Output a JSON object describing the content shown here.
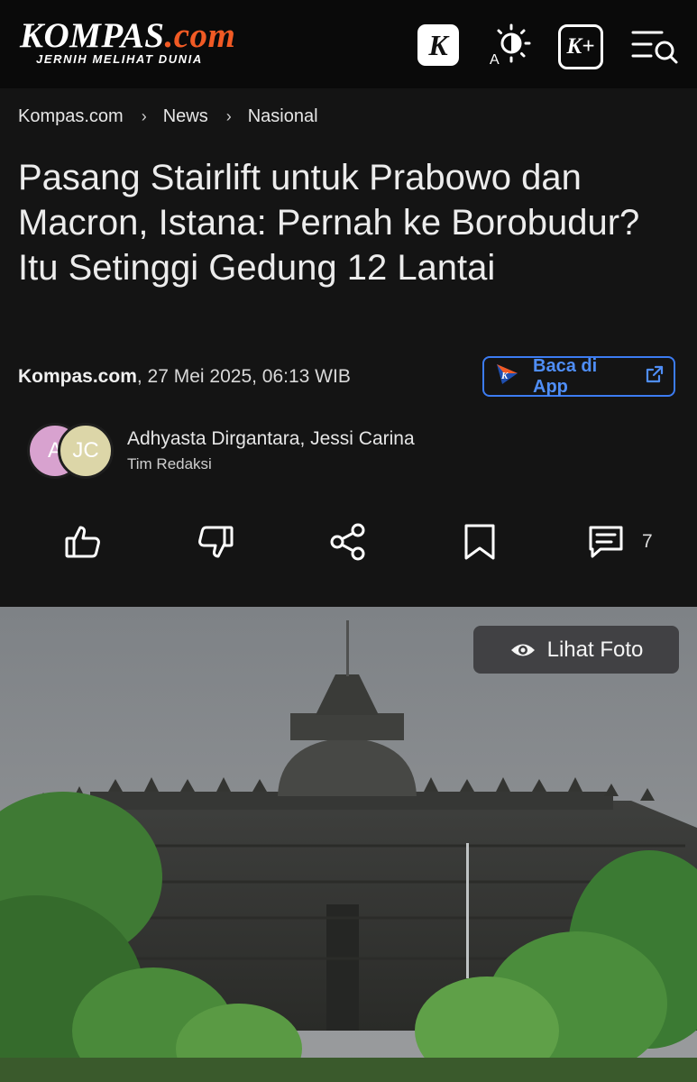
{
  "header": {
    "logo_main": "KOMPAS",
    "logo_suffix": ".com",
    "logo_tagline": "JERNIH MELIHAT DUNIA",
    "k_badge": "K",
    "kplus_badge": "K+",
    "mode_letter": "A"
  },
  "breadcrumb": [
    "Kompas.com",
    "News",
    "Nasional"
  ],
  "article": {
    "title": "Pasang Stairlift untuk Prabowo dan Macron, Istana: Pernah ke Borobudur? Itu Setinggi Gedung 12 Lantai",
    "source": "Kompas.com",
    "date": ", 27 Mei 2025, 06:13 WIB",
    "app_button": "Baca di App"
  },
  "authors": {
    "avatar1": "A",
    "avatar2": "JC",
    "names": "Adhyasta Dirgantara,  Jessi Carina",
    "team": "Tim Redaksi"
  },
  "actions": {
    "comment_count": "7"
  },
  "photo": {
    "button": "Lihat Foto"
  },
  "colors": {
    "background": "#141414",
    "topbar": "#0a0a0a",
    "accent_blue": "#3c7cf2",
    "logo_orange": "#f15a24"
  }
}
